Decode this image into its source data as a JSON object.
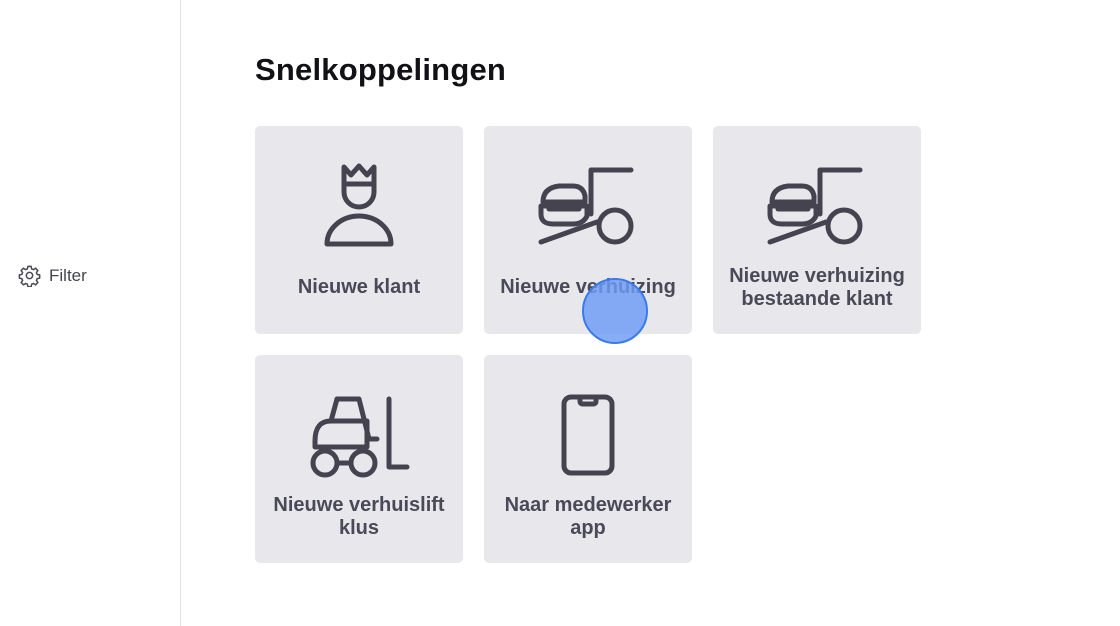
{
  "sidebar": {
    "filter": {
      "icon": "gear-icon",
      "label": "Filter"
    }
  },
  "main": {
    "title": "Snelkoppelingen",
    "shortcuts": [
      {
        "icon": "customer-crown-icon",
        "label": "Nieuwe klant"
      },
      {
        "icon": "moving-truck-icon",
        "label": "Nieuwe verhuizing"
      },
      {
        "icon": "moving-truck-icon",
        "label": "Nieuwe verhuizing bestaande klant"
      },
      {
        "icon": "forklift-icon",
        "label": "Nieuwe verhuislift klus"
      },
      {
        "icon": "smartphone-icon",
        "label": "Naar medewerker app"
      }
    ]
  },
  "colors": {
    "card_background": "#e8e8ec",
    "icon_stroke": "#44434f",
    "click_indicator": "#6e9bf5"
  }
}
